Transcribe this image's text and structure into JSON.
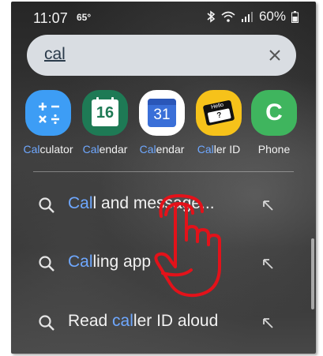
{
  "status": {
    "time": "11:07",
    "temp": "65°",
    "battery": "60%"
  },
  "search": {
    "query": "cal"
  },
  "apps": [
    {
      "prefix": "Cal",
      "suffix": "culator",
      "icon": "calculator-icon",
      "color": "#3d9df5"
    },
    {
      "prefix": "Cal",
      "suffix": "endar",
      "icon": "calendar-16-icon",
      "color": "#1e7a55",
      "icon_text": "16"
    },
    {
      "prefix": "Cal",
      "suffix": "endar",
      "icon": "calendar-31-icon",
      "color": "#3a6fd8",
      "icon_text": "31"
    },
    {
      "prefix": "Cal",
      "suffix": "ler ID",
      "icon": "caller-id-icon",
      "color": "#f6c21a",
      "icon_text": "Hello"
    },
    {
      "prefix": "",
      "suffix": "Phone",
      "icon": "phone-icon",
      "color": "#3fb55e",
      "icon_text": "C"
    }
  ],
  "suggestions": [
    {
      "pre": "",
      "hl": "Cal",
      "post": "l and message..."
    },
    {
      "pre": "",
      "hl": "Cal",
      "post": "ling app"
    },
    {
      "pre": "Read ",
      "hl": "cal",
      "post": "ler ID aloud"
    }
  ],
  "colors": {
    "highlight": "#6fa8ff",
    "search_bg": "#d9dde2",
    "hand_annotation": "#e3121a"
  }
}
